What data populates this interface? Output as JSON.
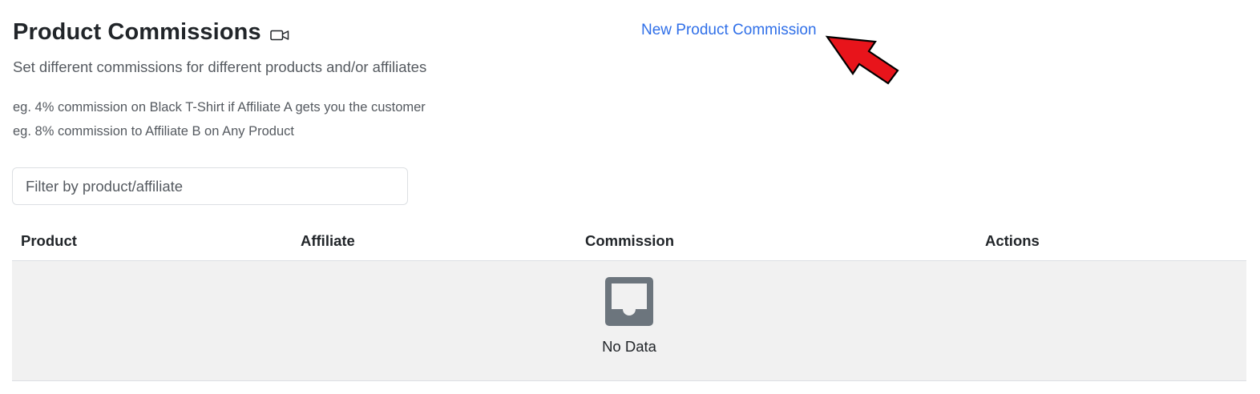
{
  "header": {
    "title": "Product Commissions",
    "video_icon": "video-camera-icon",
    "subtitle": "Set different commissions for different products and/or affiliates",
    "examples": [
      "eg. 4% commission on Black T-Shirt if Affiliate A gets you the customer",
      "eg. 8% commission to Affiliate B on Any Product"
    ]
  },
  "actions": {
    "new_commission_label": "New Product Commission"
  },
  "annotation": {
    "arrow_icon": "red-arrow-icon",
    "arrow_color": "#e8141b"
  },
  "filter": {
    "placeholder": "Filter by product/affiliate",
    "value": ""
  },
  "table": {
    "columns": [
      "Product",
      "Affiliate",
      "Commission",
      "Actions"
    ],
    "rows": [],
    "empty_icon": "empty-inbox-icon",
    "empty_text": "No Data"
  },
  "colors": {
    "link": "#2f6fe8",
    "muted_text": "#555a60",
    "empty_bg": "#f1f1f1",
    "empty_icon": "#6c757d"
  }
}
